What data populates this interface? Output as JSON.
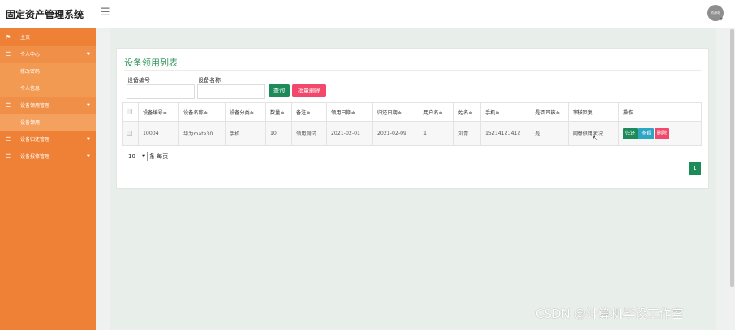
{
  "app": {
    "title": "固定资产管理系统",
    "menu_icon": "menu-icon",
    "avatar_text": "资源站"
  },
  "sidebar": {
    "items": [
      {
        "label": "主页",
        "icon": "flag-icon"
      },
      {
        "label": "个人中心",
        "icon": "menu-icon",
        "children": [
          "修改密码",
          "个人信息"
        ]
      },
      {
        "label": "设备领用管理",
        "icon": "menu-icon",
        "children": [
          "设备领用"
        ]
      },
      {
        "label": "设备归还管理",
        "icon": "menu-icon"
      },
      {
        "label": "设备报修管理",
        "icon": "menu-icon"
      }
    ]
  },
  "page": {
    "title": "设备领用列表",
    "search": {
      "field1_label": "设备编号",
      "field1_value": "",
      "field2_label": "设备名称",
      "field2_value": "",
      "query_button": "查询",
      "batch_delete_button": "批量删除"
    },
    "table": {
      "columns": [
        "",
        "设备编号≑",
        "设备名称≑",
        "设备分类≑",
        "数量≑",
        "备注≑",
        "领用日期≑",
        "归还日期≑",
        "用户名≑",
        "姓名≑",
        "手机≑",
        "是否审核≑",
        "审核回复",
        "操作"
      ],
      "rows": [
        {
          "device_no": "10004",
          "device_name": "华为mate30",
          "category": "手机",
          "quantity": "10",
          "remark": "领用测试",
          "borrow_date": "2021-02-01",
          "return_date": "2021-02-09",
          "username": "1",
          "name": "刘青",
          "phone": "15214121412",
          "audited": "是",
          "audit_reply": "同意使用状况",
          "actions": [
            "归还",
            "查看",
            "删除"
          ]
        }
      ]
    },
    "pager": {
      "page_size": "10",
      "per_page_label": "条 每页",
      "current_page": "1"
    }
  },
  "watermark": "CSDN @计算机毕设工作室",
  "colors": {
    "sidebar": "#ee8136",
    "accent_green": "#1d8a5a",
    "danger": "#f1486b",
    "info": "#2da6c4",
    "title_green": "#3a9a63"
  }
}
